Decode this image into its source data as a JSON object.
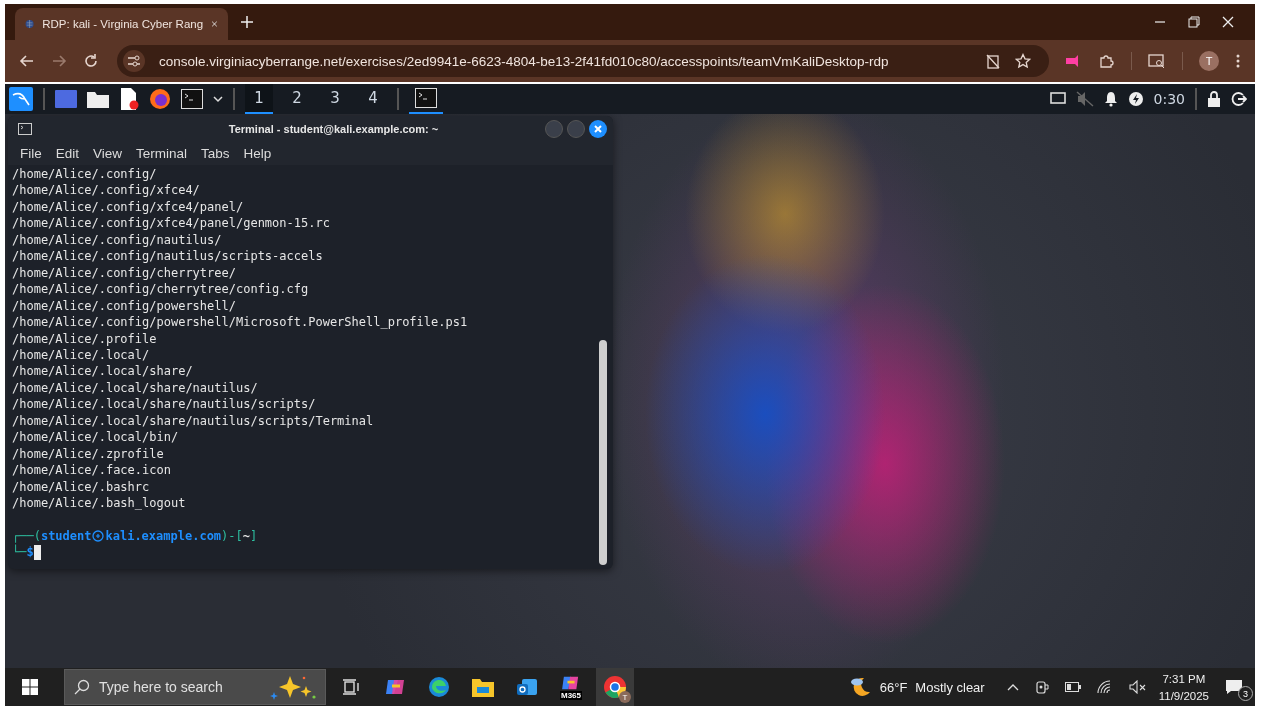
{
  "browser": {
    "tab": {
      "title": "RDP: kali - Virginia Cyber Rang",
      "selected": true
    },
    "url": "console.virginiacyberrange.net/exercises/2ed9941e-6623-4804-be13-2f41fd010c80/accesspoints/teamVmKaliDesktop-rdp",
    "profile": "T"
  },
  "kali_panel": {
    "workspaces": [
      {
        "label": "1",
        "selected": true
      },
      {
        "label": "2",
        "selected": false
      },
      {
        "label": "3",
        "selected": false
      },
      {
        "label": "4",
        "selected": false
      }
    ],
    "timer": "0:30"
  },
  "terminal": {
    "title": "Terminal - student@kali.example.com: ~",
    "menu": [
      "File",
      "Edit",
      "View",
      "Terminal",
      "Tabs",
      "Help"
    ],
    "lines": [
      "/home/Alice/.config/",
      "/home/Alice/.config/xfce4/",
      "/home/Alice/.config/xfce4/panel/",
      "/home/Alice/.config/xfce4/panel/genmon-15.rc",
      "/home/Alice/.config/nautilus/",
      "/home/Alice/.config/nautilus/scripts-accels",
      "/home/Alice/.config/cherrytree/",
      "/home/Alice/.config/cherrytree/config.cfg",
      "/home/Alice/.config/powershell/",
      "/home/Alice/.config/powershell/Microsoft.PowerShell_profile.ps1",
      "/home/Alice/.profile",
      "/home/Alice/.local/",
      "/home/Alice/.local/share/",
      "/home/Alice/.local/share/nautilus/",
      "/home/Alice/.local/share/nautilus/scripts/",
      "/home/Alice/.local/share/nautilus/scripts/Terminal",
      "/home/Alice/.local/bin/",
      "/home/Alice/.zprofile",
      "/home/Alice/.face.icon",
      "/home/Alice/.bashrc",
      "/home/Alice/.bash_logout"
    ],
    "prompt": {
      "open": "┌──(",
      "user": "student",
      "host": "kali.example.com",
      "mid": ")-[",
      "dir": "~",
      "close": "]",
      "corner": "└─",
      "symbol": "$"
    }
  },
  "taskbar": {
    "search": {
      "placeholder": "Type here to search"
    },
    "apps": [
      {
        "kind": "taskview",
        "selected": false
      },
      {
        "kind": "copilot",
        "selected": false
      },
      {
        "kind": "edge",
        "selected": false
      },
      {
        "kind": "files",
        "selected": false
      },
      {
        "kind": "outlook",
        "selected": false
      },
      {
        "kind": "m365",
        "label": "M365",
        "selected": false
      },
      {
        "kind": "chrome",
        "label": "T",
        "selected": true
      }
    ],
    "weather": {
      "temp": "66°F",
      "condition": "Mostly clear"
    },
    "time": "7:31 PM",
    "date": "11/9/2025",
    "notifications": "3"
  }
}
